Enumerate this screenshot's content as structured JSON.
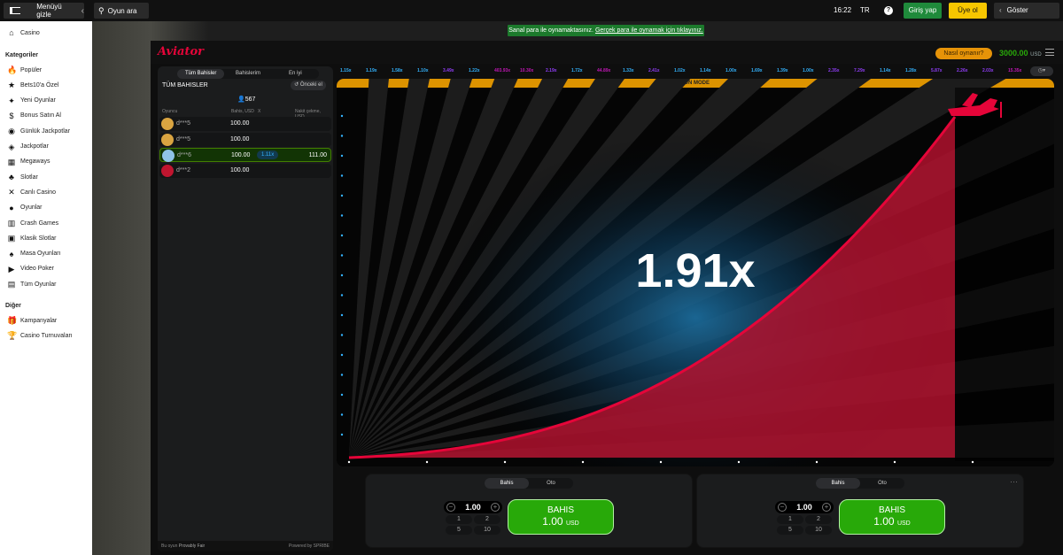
{
  "topbar": {
    "menu_label": "Menüyü gizle",
    "search_placeholder": "Oyun ara",
    "time": "16:22",
    "lang": "TR",
    "help": "?",
    "login": "Giriş yap",
    "register": "Üye ol",
    "show": "Göster"
  },
  "sidebar": {
    "top": "Casino",
    "cat_head": "Kategoriler",
    "categories": [
      "Popüler",
      "Bets10'a Özel",
      "Yeni Oyunlar",
      "Bonus Satın Al",
      "Günlük Jackpotlar",
      "Jackpotlar",
      "Megaways",
      "Slotlar",
      "Canlı Casino",
      "Oyunlar",
      "Crash Games",
      "Klasik Slotlar",
      "Masa Oyunları",
      "Video Poker",
      "Tüm Oyunlar"
    ],
    "other_head": "Diğer",
    "other": [
      "Kampanyalar",
      "Casino Turnuvaları"
    ]
  },
  "banner": {
    "text": "Sanal para ile oynamaktasınız.",
    "link": "Gerçek para ile oynamak için tıklayınız."
  },
  "game": {
    "logo": "Aviator",
    "howto": "Nasıl oynanır?",
    "balance": "3000.00",
    "currency": "USD",
    "fun_mode": "FUN MODE",
    "multiplier": "1.91x"
  },
  "bets": {
    "tabs": [
      "Tüm Bahisler",
      "Bahislerim",
      "En iyi"
    ],
    "title": "TÜM BAHISLER",
    "prev": "Önceki el",
    "count": "567",
    "col_player": "Oyuncu",
    "col_bet": "Bahis, USD",
    "col_x": "X",
    "col_win": "Nakit çekme, USD",
    "rows": [
      {
        "name": "d***5",
        "bet": "100.00",
        "mult": "",
        "win": ""
      },
      {
        "name": "d***5",
        "bet": "100.00",
        "mult": "",
        "win": ""
      },
      {
        "name": "d***6",
        "bet": "100.00",
        "mult": "1.11x",
        "win": "111.00"
      },
      {
        "name": "d***2",
        "bet": "100.00",
        "mult": "",
        "win": ""
      }
    ],
    "footer_pre": "Bu oyun",
    "footer_pf": "Provably Fair",
    "footer_powered": "Powered by SPRIBE"
  },
  "history": [
    {
      "v": "1.15x",
      "c": "#34b4ff"
    },
    {
      "v": "1.19x",
      "c": "#34b4ff"
    },
    {
      "v": "1.58x",
      "c": "#34b4ff"
    },
    {
      "v": "1.10x",
      "c": "#34b4ff"
    },
    {
      "v": "3.49x",
      "c": "#913ef8"
    },
    {
      "v": "1.22x",
      "c": "#34b4ff"
    },
    {
      "v": "403.93x",
      "c": "#c017b4"
    },
    {
      "v": "10.30x",
      "c": "#c017b4"
    },
    {
      "v": "2.19x",
      "c": "#913ef8"
    },
    {
      "v": "1.72x",
      "c": "#34b4ff"
    },
    {
      "v": "44.89x",
      "c": "#c017b4"
    },
    {
      "v": "1.33x",
      "c": "#34b4ff"
    },
    {
      "v": "2.41x",
      "c": "#913ef8"
    },
    {
      "v": "1.02x",
      "c": "#34b4ff"
    },
    {
      "v": "1.14x",
      "c": "#34b4ff"
    },
    {
      "v": "1.00x",
      "c": "#34b4ff"
    },
    {
      "v": "1.69x",
      "c": "#34b4ff"
    },
    {
      "v": "1.39x",
      "c": "#34b4ff"
    },
    {
      "v": "1.00x",
      "c": "#34b4ff"
    },
    {
      "v": "2.35x",
      "c": "#913ef8"
    },
    {
      "v": "7.29x",
      "c": "#913ef8"
    },
    {
      "v": "1.14x",
      "c": "#34b4ff"
    },
    {
      "v": "1.28x",
      "c": "#34b4ff"
    },
    {
      "v": "5.87x",
      "c": "#913ef8"
    },
    {
      "v": "2.26x",
      "c": "#913ef8"
    },
    {
      "v": "2.03x",
      "c": "#913ef8"
    },
    {
      "v": "15.35x",
      "c": "#c017b4"
    }
  ],
  "panel1": {
    "tab_bet": "Bahis",
    "tab_auto": "Oto",
    "amount": "1.00",
    "q1": "1",
    "q2": "2",
    "q3": "5",
    "q4": "10",
    "btn": "BAHIS",
    "btn_amount": "1.00",
    "btn_cur": "USD"
  },
  "panel2": {
    "tab_bet": "Bahis",
    "tab_auto": "Oto",
    "amount": "1.00",
    "q1": "1",
    "q2": "2",
    "q3": "5",
    "q4": "10",
    "btn": "BAHIS",
    "btn_amount": "1.00",
    "btn_cur": "USD"
  }
}
